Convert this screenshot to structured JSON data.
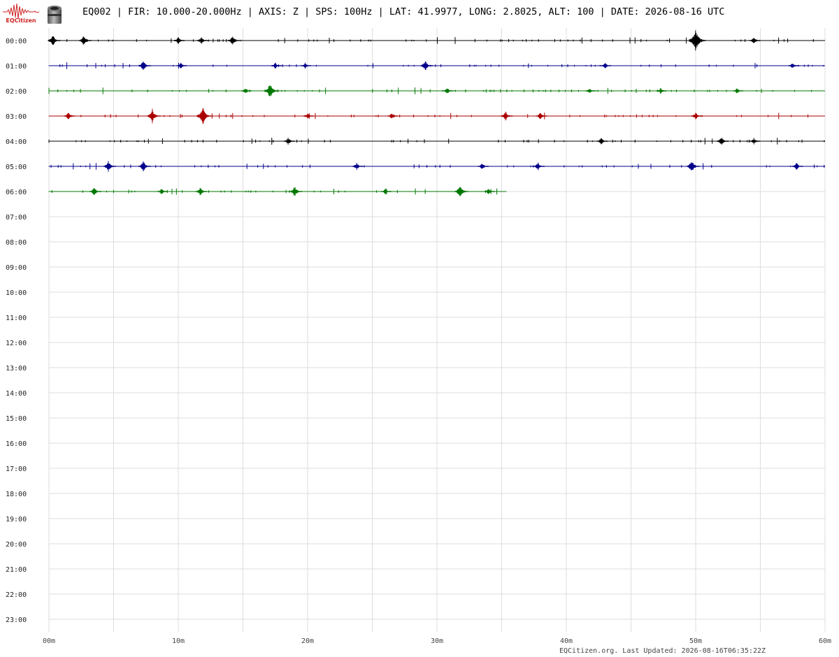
{
  "header": {
    "logo_text": "EQCitizen",
    "title": "EQ002 | FIR: 10.000-20.000Hz | AXIS: Z | SPS: 100Hz | LAT: 41.9977, LONG: 2.8025, ALT: 100 | DATE: 2026-08-16 UTC",
    "icons": [
      "eqcitizen-seismogram-logo-icon",
      "sensor-canister-icon"
    ]
  },
  "colors": {
    "trace_cycle": [
      "#000000",
      "#00008b",
      "#007700",
      "#aa0000"
    ],
    "grid": "#dddddd",
    "brand": "#cc2222"
  },
  "chart_data": {
    "type": "line",
    "subtype": "helicorder",
    "title": "",
    "xlabel": "",
    "ylabel": "",
    "x_range_minutes": [
      0,
      60
    ],
    "x_ticks": [
      "00m",
      "10m",
      "20m",
      "30m",
      "40m",
      "50m",
      "60m"
    ],
    "x_minor_step_minutes": 5,
    "y_labels": [
      "00:00",
      "01:00",
      "02:00",
      "03:00",
      "04:00",
      "05:00",
      "06:00",
      "07:00",
      "08:00",
      "09:00",
      "10:00",
      "11:00",
      "12:00",
      "13:00",
      "14:00",
      "15:00",
      "16:00",
      "17:00",
      "18:00",
      "19:00",
      "20:00",
      "21:00",
      "22:00",
      "23:00"
    ],
    "grid": true,
    "legend": "none",
    "rows": [
      {
        "hour": "00:00",
        "color": "#000000",
        "end_minute": 60,
        "events": [
          [
            0.3,
            0.5
          ],
          [
            2.7,
            0.5
          ],
          [
            10.0,
            0.35
          ],
          [
            11.8,
            0.4
          ],
          [
            14.2,
            0.45
          ],
          [
            50.0,
            1.0
          ],
          [
            54.5,
            0.35
          ]
        ]
      },
      {
        "hour": "01:00",
        "color": "#00008b",
        "end_minute": 60,
        "events": [
          [
            7.3,
            0.5
          ],
          [
            10.2,
            0.3
          ],
          [
            17.5,
            0.3
          ],
          [
            19.8,
            0.3
          ],
          [
            29.1,
            0.5
          ],
          [
            43.0,
            0.3
          ],
          [
            57.5,
            0.3
          ]
        ]
      },
      {
        "hour": "02:00",
        "color": "#007700",
        "end_minute": 60,
        "events": [
          [
            17.1,
            0.75
          ],
          [
            15.2,
            0.3
          ],
          [
            30.8,
            0.3
          ],
          [
            41.8,
            0.25
          ],
          [
            47.3,
            0.3
          ],
          [
            53.2,
            0.3
          ]
        ]
      },
      {
        "hour": "03:00",
        "color": "#aa0000",
        "end_minute": 60,
        "events": [
          [
            1.5,
            0.35
          ],
          [
            8.0,
            0.65
          ],
          [
            11.9,
            0.8
          ],
          [
            20.0,
            0.3
          ],
          [
            26.5,
            0.3
          ],
          [
            35.3,
            0.45
          ],
          [
            38.0,
            0.35
          ],
          [
            50.0,
            0.35
          ]
        ]
      },
      {
        "hour": "04:00",
        "color": "#000000",
        "end_minute": 60,
        "events": [
          [
            18.5,
            0.35
          ],
          [
            42.7,
            0.35
          ],
          [
            52.0,
            0.45
          ],
          [
            54.5,
            0.3
          ]
        ]
      },
      {
        "hour": "05:00",
        "color": "#00008b",
        "end_minute": 60,
        "events": [
          [
            4.6,
            0.5
          ],
          [
            7.3,
            0.5
          ],
          [
            23.8,
            0.35
          ],
          [
            33.5,
            0.35
          ],
          [
            37.8,
            0.4
          ],
          [
            49.7,
            0.6
          ],
          [
            57.8,
            0.35
          ]
        ]
      },
      {
        "hour": "06:00",
        "color": "#007700",
        "end_minute": 35.37,
        "events": [
          [
            3.5,
            0.45
          ],
          [
            8.7,
            0.3
          ],
          [
            11.7,
            0.4
          ],
          [
            19.0,
            0.5
          ],
          [
            26.0,
            0.3
          ],
          [
            31.8,
            0.6
          ],
          [
            34.0,
            0.3
          ]
        ]
      }
    ]
  },
  "footer": {
    "text": "EQCitizen.org. Last Updated: 2026-08-16T06:35:22Z"
  }
}
